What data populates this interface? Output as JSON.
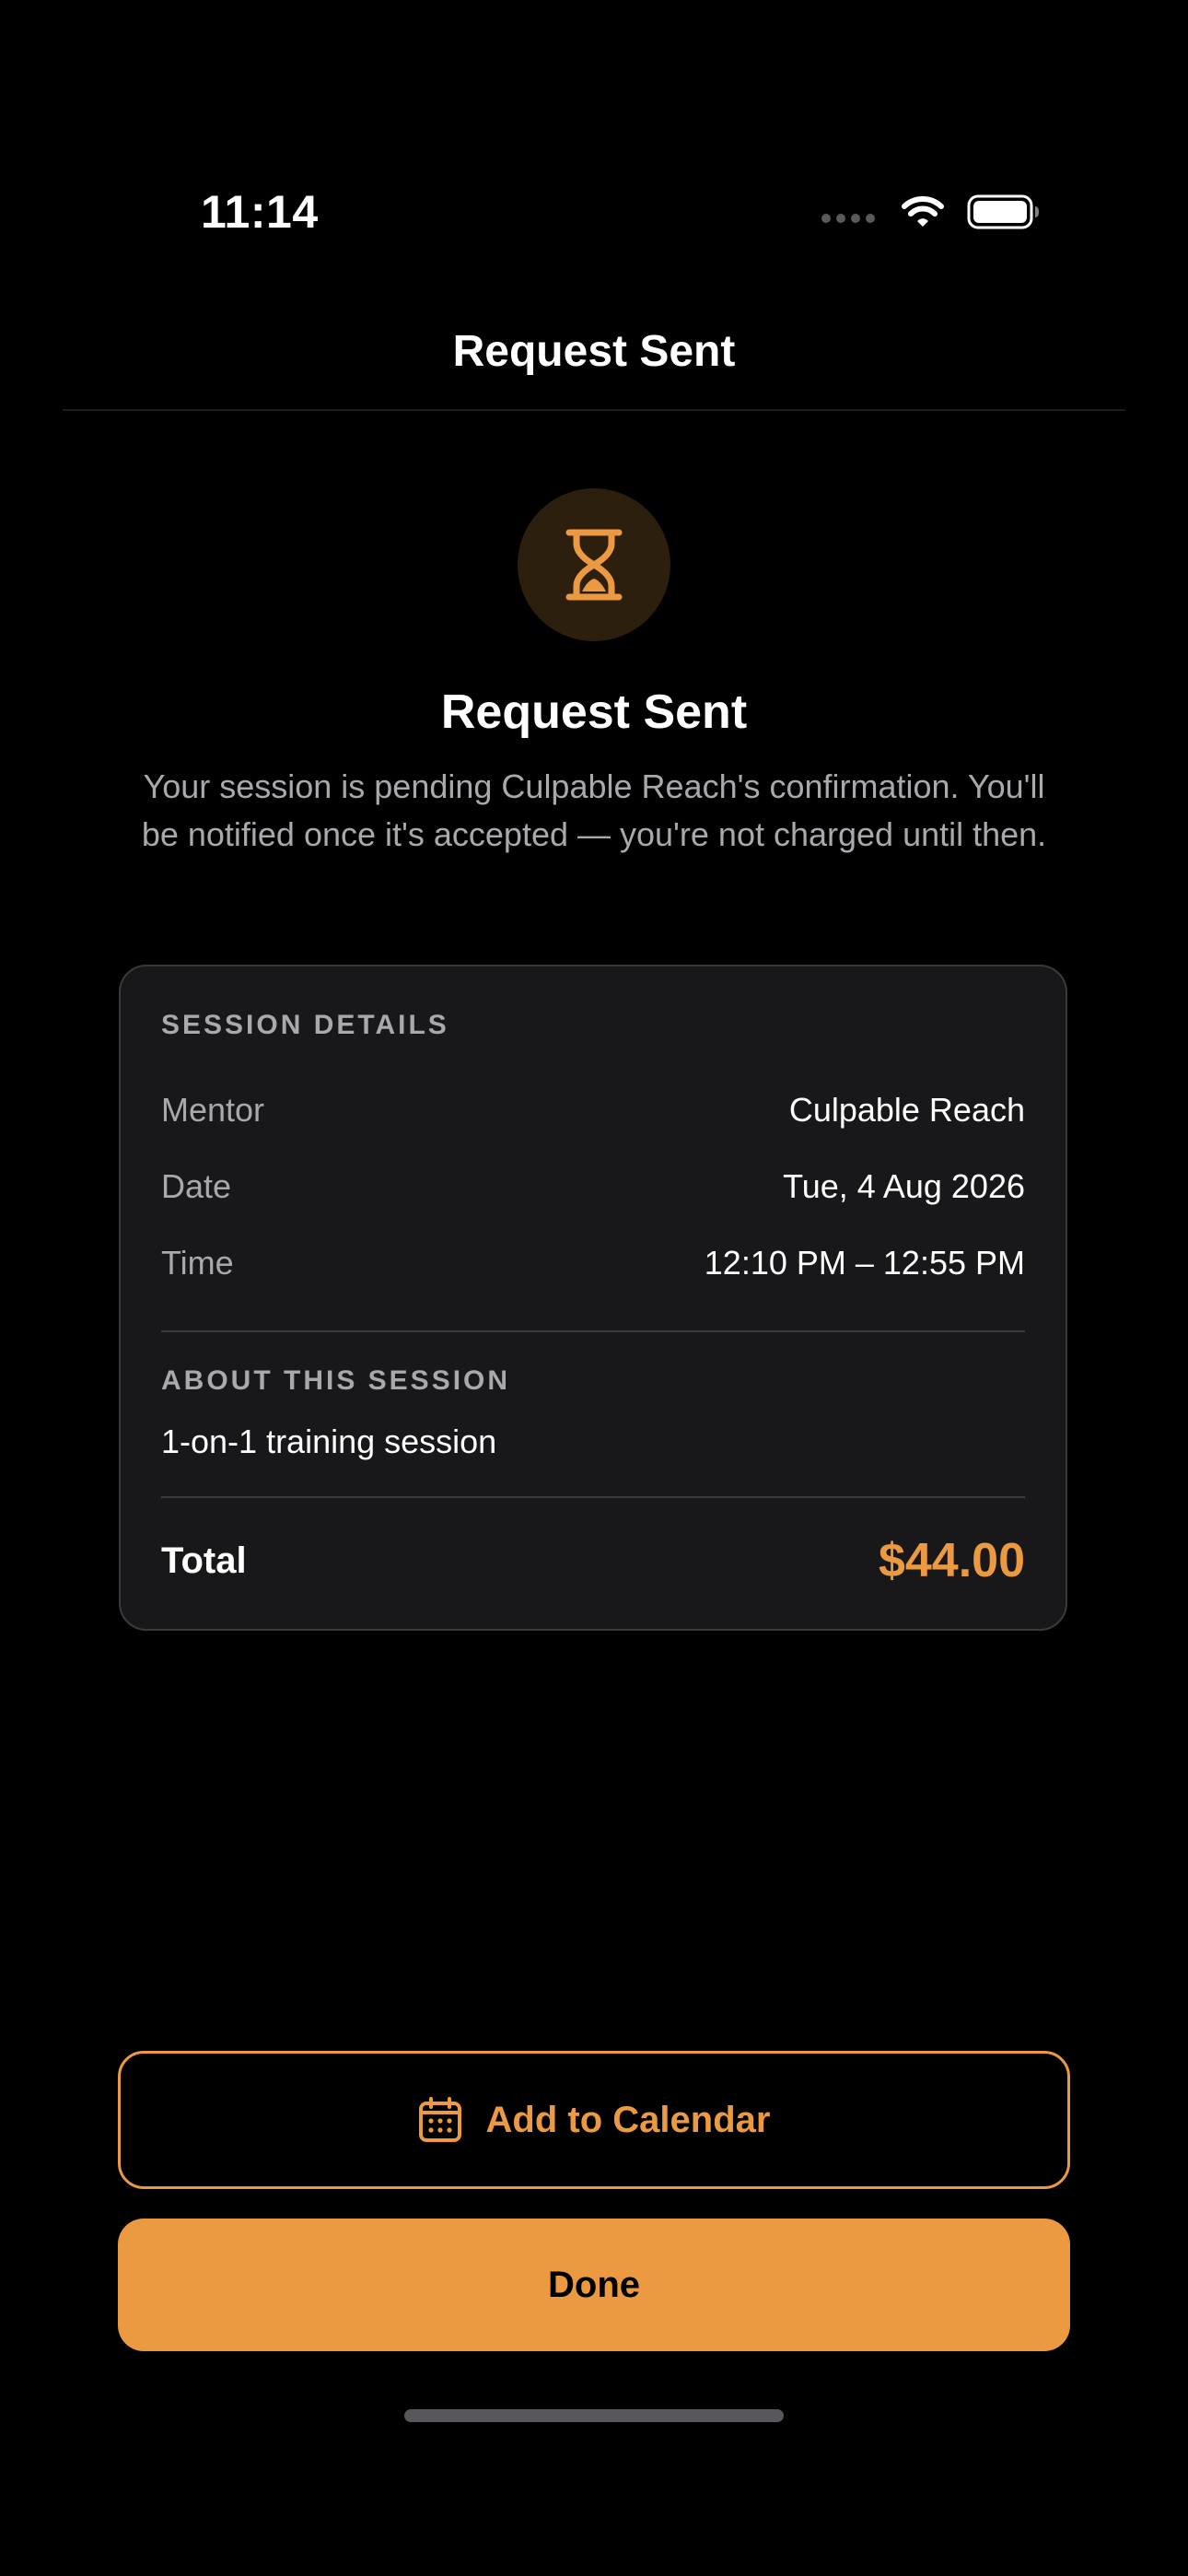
{
  "status_bar": {
    "time": "11:14",
    "icons": [
      "cellular-dots-icon",
      "wifi-icon",
      "battery-icon"
    ]
  },
  "nav": {
    "title": "Request Sent"
  },
  "status": {
    "icon": "hourglass-icon",
    "headline": "Request Sent",
    "message": "Your session is pending Culpable Reach's confirmation. You'll be notified once it's accepted — you're not charged until then."
  },
  "details": {
    "section_label": "SESSION DETAILS",
    "rows": [
      {
        "label": "Mentor",
        "value": "Culpable Reach"
      },
      {
        "label": "Date",
        "value": "Tue, 4 Aug 2026"
      },
      {
        "label": "Time",
        "value": "12:10 PM – 12:55 PM"
      }
    ],
    "about_label": "ABOUT THIS SESSION",
    "about_text": "1-on-1 training session",
    "total_label": "Total",
    "total_value": "$44.00"
  },
  "actions": {
    "calendar_label": "Add to Calendar",
    "calendar_icon": "calendar-icon",
    "done_label": "Done"
  },
  "colors": {
    "accent": "#eb9a41",
    "background": "#000000",
    "card": "#18181a",
    "secondary_text": "#a8a8ad"
  }
}
